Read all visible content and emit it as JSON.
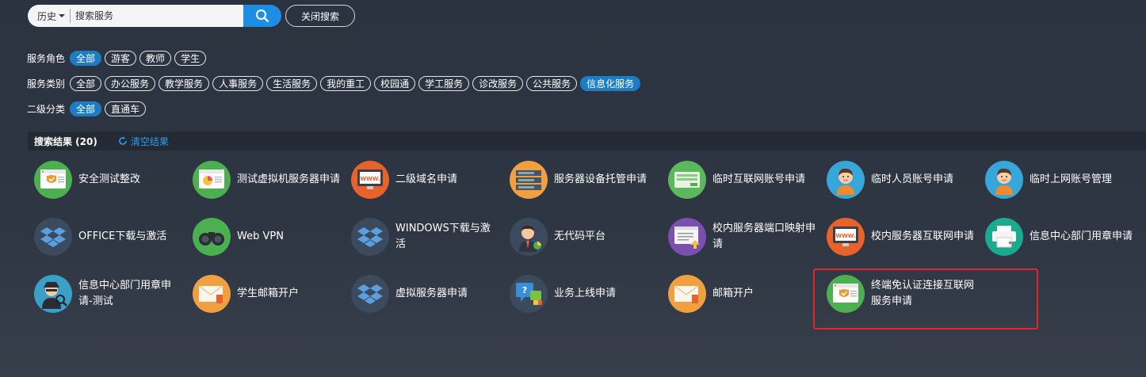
{
  "search": {
    "history_label": "历史",
    "placeholder": "搜索服务",
    "close_label": "关闭搜索"
  },
  "filters": {
    "role": {
      "label": "服务角色",
      "options": [
        "全部",
        "游客",
        "教师",
        "学生"
      ],
      "active": "全部"
    },
    "category": {
      "label": "服务类别",
      "options": [
        "全部",
        "办公服务",
        "教学服务",
        "人事服务",
        "生活服务",
        "我的重工",
        "校园通",
        "学工服务",
        "诊改服务",
        "公共服务",
        "信息化服务"
      ],
      "active": "信息化服务"
    },
    "sub": {
      "label": "二级分类",
      "options": [
        "全部",
        "直通车"
      ],
      "active": "全部"
    }
  },
  "results": {
    "count_label": "搜索结果 (20)",
    "clear_label": "清空结果"
  },
  "services": [
    {
      "name": "安全测试整改",
      "icon": "shield-screen-icon",
      "bg": "#4caf50"
    },
    {
      "name": "测试虚拟机服务器申请",
      "icon": "dashboard-screen-icon",
      "bg": "#4caf50"
    },
    {
      "name": "二级域名申请",
      "icon": "www-monitor-icon",
      "bg": "#e8622c"
    },
    {
      "name": "服务器设备托管申请",
      "icon": "server-rack-icon",
      "bg": "#f0a040"
    },
    {
      "name": "临时互联网账号申请",
      "icon": "network-device-icon",
      "bg": "#5cb85c"
    },
    {
      "name": "临时人员账号申请",
      "icon": "person-icon",
      "bg": "#37a6d8"
    },
    {
      "name": "临时上网账号管理",
      "icon": "person-icon",
      "bg": "#37a6d8"
    },
    {
      "name": "OFFICE下载与激活",
      "icon": "dropbox-icon",
      "bg": "#3c4a5e"
    },
    {
      "name": "Web VPN",
      "icon": "binoculars-icon",
      "bg": "#4caf50"
    },
    {
      "name": "WINDOWS下载与激活",
      "icon": "dropbox-icon",
      "bg": "#3c4a5e"
    },
    {
      "name": "无代码平台",
      "icon": "businessman-icon",
      "bg": "#3c4a5e"
    },
    {
      "name": "校内服务器端口映射申请",
      "icon": "port-window-icon",
      "bg": "#7a4fb0"
    },
    {
      "name": "校内服务器互联网申请",
      "icon": "www-monitor-icon",
      "bg": "#e8622c"
    },
    {
      "name": "信息中心部门用章申请",
      "icon": "printer-icon",
      "bg": "#1aaa8f"
    },
    {
      "name": "信息中心部门用章申请-测试",
      "icon": "spy-icon",
      "bg": "#3aa0c8"
    },
    {
      "name": "学生邮箱开户",
      "icon": "envelope-icon",
      "bg": "#f0a040"
    },
    {
      "name": "虚拟服务器申请",
      "icon": "dropbox-icon",
      "bg": "#3c4a5e"
    },
    {
      "name": "业务上线申请",
      "icon": "help-chat-icon",
      "bg": "#3c4a5e"
    },
    {
      "name": "邮箱开户",
      "icon": "envelope-icon",
      "bg": "#f0a040"
    },
    {
      "name": "终端免认证连接互联网服务申请",
      "icon": "shield-screen-icon",
      "bg": "#4caf50"
    }
  ]
}
